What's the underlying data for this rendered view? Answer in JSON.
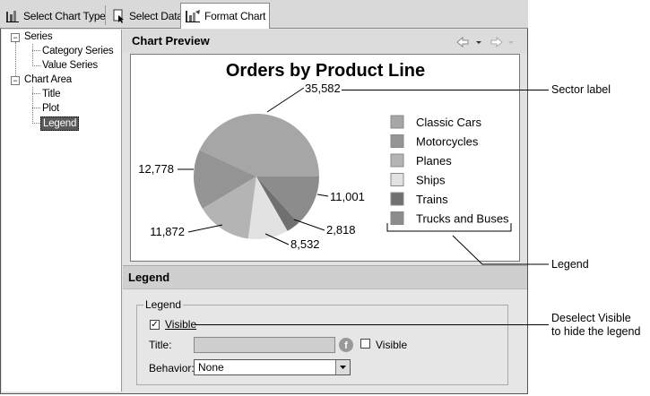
{
  "tabs": [
    {
      "label": "Select Chart Type",
      "active": false,
      "icon": "chart-type-icon"
    },
    {
      "label": "Select Data",
      "active": false,
      "icon": "select-data-icon"
    },
    {
      "label": "Format Chart",
      "active": true,
      "icon": "format-chart-icon"
    }
  ],
  "tree": {
    "series": "Series",
    "category_series": "Category Series",
    "value_series": "Value Series",
    "chart_area": "Chart Area",
    "title": "Title",
    "plot": "Plot",
    "legend": "Legend",
    "expand_symbol": "−"
  },
  "preview": {
    "heading": "Chart Preview",
    "nav_icons": [
      "back-arrow-icon",
      "dropdown-icon",
      "forward-arrow-icon",
      "dropdown-icon"
    ]
  },
  "chart_data": {
    "type": "pie",
    "title": "Orders by Product Line",
    "categories": [
      "Classic Cars",
      "Motorcycles",
      "Planes",
      "Ships",
      "Trains",
      "Trucks and Buses"
    ],
    "values": [
      35582,
      12778,
      11872,
      8532,
      2818,
      11001
    ],
    "value_labels": [
      "35,582",
      "12,778",
      "11,872",
      "8,532",
      "2,818",
      "11,001"
    ],
    "colors": [
      "#a6a6a6",
      "#949494",
      "#b4b4b4",
      "#e2e2e2",
      "#707070",
      "#8c8c8c"
    ],
    "legend_position": "right"
  },
  "legend_section": {
    "heading": "Legend",
    "group_label": "Legend",
    "visible_label": "Visible",
    "visible_checked": true,
    "title_label": "Title:",
    "title_value": "",
    "title_visible_label": "Visible",
    "title_visible_checked": false,
    "behavior_label": "Behavior:",
    "behavior_value": "None"
  },
  "callouts": {
    "sector_label": "Sector label",
    "legend": "Legend",
    "deselect_line1": "Deselect Visible",
    "deselect_line2": "to hide the legend"
  }
}
